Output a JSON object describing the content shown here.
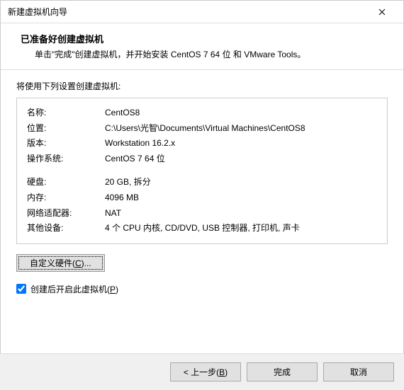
{
  "window": {
    "title": "新建虚拟机向导"
  },
  "header": {
    "title": "已准备好创建虚拟机",
    "desc": "单击\"完成\"创建虚拟机，并开始安装 CentOS 7 64 位 和 VMware Tools。"
  },
  "intro": "将使用下列设置创建虚拟机:",
  "summary": {
    "name_label": "名称:",
    "name_value": "CentOS8",
    "location_label": "位置:",
    "location_value": "C:\\Users\\光智\\Documents\\Virtual Machines\\CentOS8",
    "version_label": "版本:",
    "version_value": "Workstation 16.2.x",
    "os_label": "操作系统:",
    "os_value": "CentOS 7 64 位",
    "disk_label": "硬盘:",
    "disk_value": "20 GB, 拆分",
    "memory_label": "内存:",
    "memory_value": "4096 MB",
    "network_label": "网络适配器:",
    "network_value": "NAT",
    "other_label": "其他设备:",
    "other_value": "4 个 CPU 内核, CD/DVD, USB 控制器, 打印机, 声卡"
  },
  "buttons": {
    "customize_pre": "自定义硬件(",
    "customize_u": "C",
    "customize_post": ")...",
    "poweron_pre": "创建后开启此虚拟机(",
    "poweron_u": "P",
    "poweron_post": ")",
    "back_pre": "< 上一步(",
    "back_u": "B",
    "back_post": ")",
    "finish": "完成",
    "cancel": "取消"
  }
}
